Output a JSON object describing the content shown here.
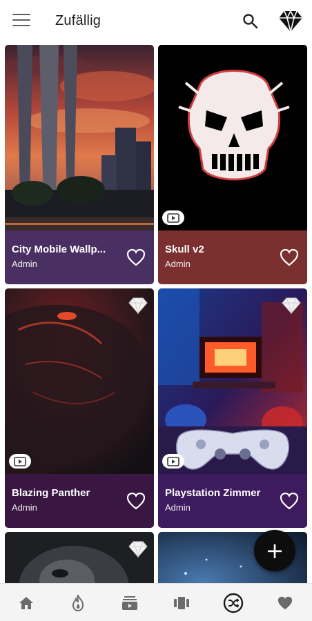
{
  "app_bar": {
    "title": "Zufällig",
    "icons": [
      "menu-icon",
      "search-icon",
      "diamond-icon"
    ]
  },
  "cards": [
    {
      "title": "City Mobile Wallp...",
      "author": "Admin",
      "footer_color": "#4a2f63",
      "video": false,
      "premium": false
    },
    {
      "title": "Skull v2",
      "author": "Admin",
      "footer_color": "#7b2f2f",
      "video": true,
      "premium": false
    },
    {
      "title": "Blazing Panther",
      "author": "Admin",
      "footer_color": "#3a1642",
      "video": true,
      "premium": true
    },
    {
      "title": "Playstation Zimmer",
      "author": "Admin",
      "footer_color": "#3e1a5e",
      "video": true,
      "premium": true
    },
    {
      "title": "",
      "author": "",
      "footer_color": "#2a2a2a",
      "video": false,
      "premium": true
    },
    {
      "title": "",
      "author": "",
      "footer_color": "#1c2a3a",
      "video": false,
      "premium": false
    }
  ],
  "fab": {
    "icon": "plus-icon",
    "label": "+"
  },
  "bottom_nav": {
    "items": [
      "home-icon",
      "flame-icon",
      "collections-icon",
      "cards-icon",
      "shuffle-icon",
      "favorite-icon"
    ],
    "active": "shuffle-icon"
  },
  "colors": {
    "icon_gray": "#6b6b6b",
    "active_icon": "#1a1a1a",
    "card_text": "#ffffff"
  }
}
